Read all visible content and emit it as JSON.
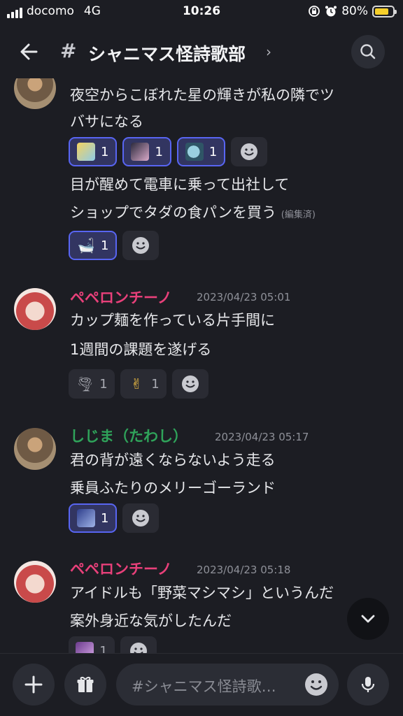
{
  "status": {
    "carrier": "docomo",
    "network": "4G",
    "time": "10:26",
    "battery": "80%",
    "battery_color": "#f6cf2a"
  },
  "header": {
    "hash": "#",
    "channel": "シャニマス怪詩歌部",
    "chevron": "›"
  },
  "messages": {
    "m0": {
      "lines": [
        "夜空からこぼれた星の輝きが私の隣でツ",
        "バサになる"
      ],
      "reactions": [
        "1",
        "1",
        "1"
      ]
    },
    "m1": {
      "lines": [
        "目が醒めて電車に乗って出社して",
        "ショップでタダの食パンを買う"
      ],
      "edited": "(編集済)",
      "reactions": [
        "1"
      ],
      "reaction_emoji": "🛁"
    },
    "m2": {
      "author": "ペペロンチーノ",
      "author_color": "#e8407a",
      "time": "2023/04/23 05:01",
      "lines": [
        "カップ麺を作っている片手間に",
        "1週間の課題を遂げる"
      ],
      "reactions": [
        "1",
        "1"
      ],
      "reaction_emoji": [
        "🌪",
        "✌"
      ]
    },
    "m3": {
      "author": "しじま（たわし）",
      "author_color": "#2fa35a",
      "time": "2023/04/23 05:17",
      "lines": [
        "君の背が遠くならないよう走る",
        "乗員ふたりのメリーゴーランド"
      ],
      "reactions": [
        "1"
      ]
    },
    "m4": {
      "author": "ペペロンチーノ",
      "author_color": "#e8407a",
      "time": "2023/04/23 05:18",
      "lines": [
        "アイドルも「野菜マシマシ」というんだ",
        "案外身近な気がしたんだ"
      ],
      "reactions": [
        "1"
      ]
    }
  },
  "composer": {
    "placeholder": "#シャニマス怪詩歌…"
  }
}
